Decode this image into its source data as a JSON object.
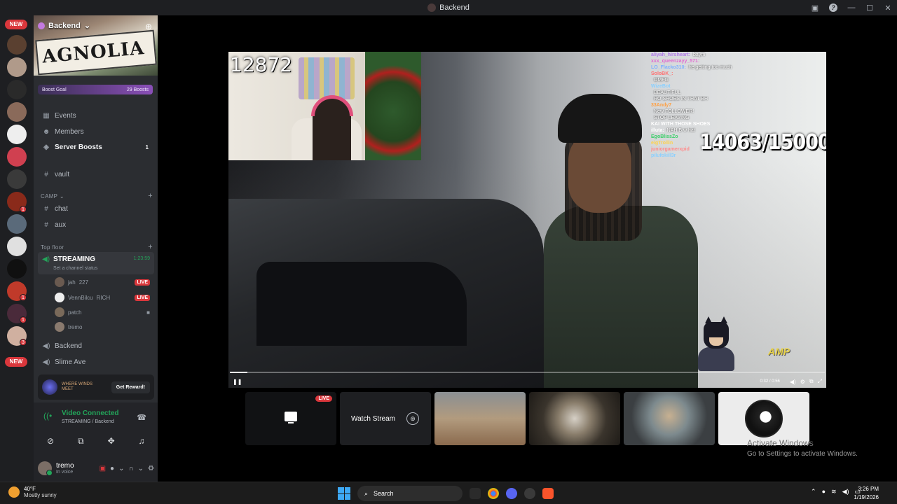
{
  "window": {
    "title": "Backend",
    "help_glyph": "?"
  },
  "rail": {
    "new_badges": [
      "NEW",
      "NEW"
    ],
    "unread_counts": [
      "1",
      "1",
      "1",
      "3"
    ]
  },
  "server": {
    "name": "Backend",
    "banner_text": "AGNOLIA",
    "banner_sub": "ST",
    "boost_goal_label": "Boost Goal",
    "boost_count": "29 Boosts"
  },
  "nav": {
    "events": "Events",
    "members": "Members",
    "server_boosts": "Server Boosts",
    "server_boosts_count": "1"
  },
  "channels": {
    "vault": "vault",
    "camp_category": "CAMP",
    "chat": "chat",
    "aux": "aux",
    "top_floor_category": "Top floor",
    "streaming": {
      "name": "STREAMING",
      "status": "Set a channel status",
      "timer": "1:23:59"
    },
    "voice_users": [
      {
        "name": "jah",
        "extra": "227",
        "live": "LIVE"
      },
      {
        "name": "VennBilcu",
        "extra": "RICH",
        "live": "LIVE"
      },
      {
        "name": "patch",
        "extra": "",
        "live": ""
      },
      {
        "name": "tremo",
        "extra": "",
        "live": ""
      }
    ],
    "backend": "Backend",
    "slime_ave": "Slime Ave"
  },
  "promo": {
    "brand": "WHERE WINDS MEET",
    "button": "Get Reward!"
  },
  "voice": {
    "title": "Video Connected",
    "subtitle": "STREAMING / Backend"
  },
  "user": {
    "name": "tremo",
    "status": "In voice"
  },
  "stream": {
    "viewer_count": "12872",
    "sub_goal": "14063/15000",
    "progress": 0.03,
    "time": "0:32 / 0:56",
    "overlay_brand": "AMP",
    "chat": [
      {
        "user": "aliyah_hirsheart:",
        "msg": "baym",
        "color": "#b07ce8"
      },
      {
        "user": "xxx_queenzayy_571:",
        "msg": "",
        "color": "#e06ad0"
      },
      {
        "user": "LO_Flacko310:",
        "msg": "he getting too much",
        "color": "#7fb0ff"
      },
      {
        "user": "SoloBK_:",
        "msg": "",
        "color": "#ff7070"
      },
      {
        "user": "",
        "msg": "OMFG",
        "color": "#ffffff"
      },
      {
        "user": "WizeBot",
        "msg": "",
        "color": "#8ad0ff"
      },
      {
        "user": "",
        "msg": "BEAUTIFUL",
        "color": "#ffffff"
      },
      {
        "user": "",
        "msg": "RO SHOES IN THAT BH",
        "color": "#ffffff"
      },
      {
        "user": "33Andy7",
        "msg": "",
        "color": "#ff9f40"
      },
      {
        "user": "",
        "msg": "New FOLLOWER!",
        "color": "#ffffff"
      },
      {
        "user": "",
        "msg": "STOP LEAVING",
        "color": "#ffffff"
      },
      {
        "user": "KAI WITH THOSE SHOES",
        "msg": "",
        "color": "#ffffff"
      },
      {
        "user": "illuta:",
        "msg": "NAH B w hat",
        "color": "#ffffff"
      },
      {
        "user": "EgoBlissZo",
        "msg": "",
        "color": "#3ccf6a"
      },
      {
        "user": "eigTrollin",
        "msg": "",
        "color": "#ffd24a"
      },
      {
        "user": "juniorgamerxpid",
        "msg": "",
        "color": "#ff8a8a"
      },
      {
        "user": "pilufokill3r",
        "msg": "",
        "color": "#8ad0ff"
      }
    ]
  },
  "tiles": {
    "live_label": "LIVE",
    "watch_stream": "Watch Stream"
  },
  "activation": {
    "line1": "Activate Windows",
    "line2": "Go to Settings to activate Windows."
  },
  "taskbar": {
    "temp": "40°F",
    "weather": "Mostly sunny",
    "search": "Search",
    "time": "3:26 PM",
    "date": "1/19/2026"
  }
}
